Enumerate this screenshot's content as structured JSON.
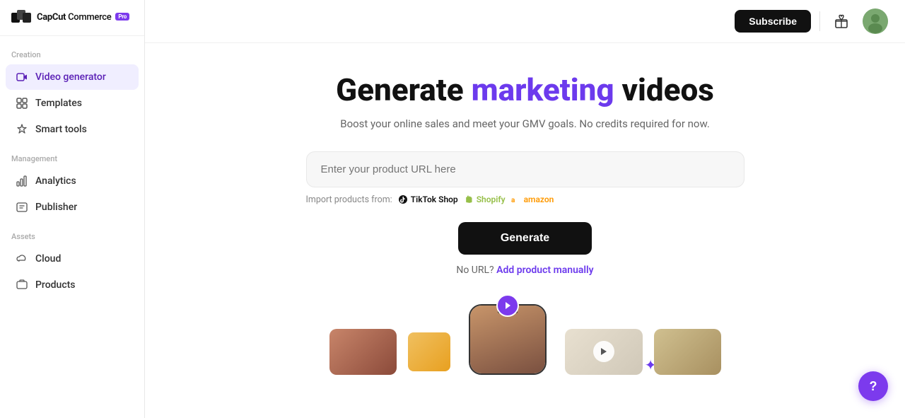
{
  "brand": {
    "name": "CapCut",
    "sub": "Commerce",
    "pro_label": "Pro"
  },
  "sidebar": {
    "creation_label": "Creation",
    "management_label": "Management",
    "assets_label": "Assets",
    "items": [
      {
        "id": "video-generator",
        "label": "Video generator",
        "active": true
      },
      {
        "id": "templates",
        "label": "Templates",
        "active": false
      },
      {
        "id": "smart-tools",
        "label": "Smart tools",
        "active": false
      },
      {
        "id": "analytics",
        "label": "Analytics",
        "active": false
      },
      {
        "id": "publisher",
        "label": "Publisher",
        "active": false
      },
      {
        "id": "cloud",
        "label": "Cloud",
        "active": false
      },
      {
        "id": "products",
        "label": "Products",
        "active": false
      }
    ]
  },
  "header": {
    "subscribe_label": "Subscribe"
  },
  "hero": {
    "title_start": "Generate ",
    "title_highlight": "marketing",
    "title_end": " videos",
    "subtitle": "Boost your online sales and meet your GMV goals. No credits required for now.",
    "input_placeholder": "Enter your product URL here",
    "import_label": "Import products from:",
    "platforms": [
      "TikTok Shop",
      "Shopify",
      "amazon"
    ],
    "generate_label": "Generate",
    "no_url_label": "No URL?",
    "add_manual_label": "Add product manually"
  }
}
